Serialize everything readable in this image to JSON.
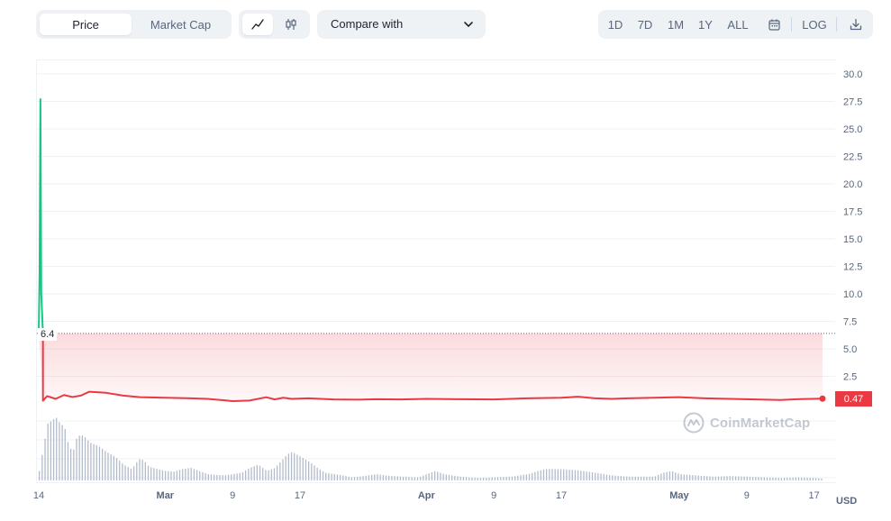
{
  "toolbar": {
    "type_tabs": [
      {
        "label": "Price",
        "active": true
      },
      {
        "label": "Market Cap",
        "active": false
      }
    ],
    "chart_types": [
      {
        "icon": "line-chart-icon",
        "active": true
      },
      {
        "icon": "candlestick-icon",
        "active": false
      }
    ],
    "compare": {
      "label": "Compare with",
      "icon": "chevron-down-icon"
    },
    "ranges": [
      {
        "label": "1D"
      },
      {
        "label": "7D"
      },
      {
        "label": "1M"
      },
      {
        "label": "1Y"
      },
      {
        "label": "ALL"
      }
    ],
    "calendar_icon": "calendar-icon",
    "log_label": "LOG",
    "download_icon": "download-icon"
  },
  "chart": {
    "open_value": "6.4",
    "last_value": "0.47",
    "currency": "USD",
    "watermark": "CoinMarketCap",
    "colors": {
      "up": "#16c784",
      "down": "#ea3943",
      "grid": "#eff2f5",
      "volume": "#a6b0c3"
    }
  },
  "chart_data": {
    "type": "line",
    "y_ticks": [
      "30.0",
      "27.5",
      "25.0",
      "22.5",
      "20.0",
      "17.5",
      "15.0",
      "12.5",
      "10.0",
      "7.5",
      "5.0",
      "2.5"
    ],
    "ylim": [
      0,
      31.25
    ],
    "x_ticks": [
      {
        "label": "14",
        "bold": false
      },
      {
        "label": "Mar",
        "bold": true
      },
      {
        "label": "9",
        "bold": false
      },
      {
        "label": "17",
        "bold": false
      },
      {
        "label": "Apr",
        "bold": true
      },
      {
        "label": "9",
        "bold": false
      },
      {
        "label": "17",
        "bold": false
      },
      {
        "label": "May",
        "bold": true
      },
      {
        "label": "9",
        "bold": false
      },
      {
        "label": "17",
        "bold": false
      }
    ],
    "x_tick_days": [
      0,
      15,
      23,
      31,
      46,
      54,
      62,
      76,
      84,
      92
    ],
    "x_range_days": [
      0,
      93
    ],
    "reference_value": 6.4,
    "series": [
      {
        "days": [
          0,
          0.1,
          0.2,
          0.3,
          0.5,
          1,
          2,
          3,
          4,
          5,
          6,
          8,
          10,
          12,
          15,
          18,
          20,
          23,
          25,
          27,
          28,
          29,
          30,
          32,
          35,
          38,
          40,
          43,
          46,
          50,
          54,
          58,
          62,
          64,
          66,
          68,
          70,
          73,
          76,
          79,
          82,
          85,
          88,
          90,
          93
        ],
        "values": [
          6.4,
          12.0,
          27.7,
          10.0,
          0.28,
          0.7,
          0.45,
          0.8,
          0.62,
          0.75,
          1.1,
          1.0,
          0.75,
          0.6,
          0.55,
          0.5,
          0.45,
          0.25,
          0.3,
          0.6,
          0.4,
          0.55,
          0.45,
          0.5,
          0.4,
          0.38,
          0.42,
          0.4,
          0.45,
          0.42,
          0.4,
          0.5,
          0.55,
          0.65,
          0.5,
          0.45,
          0.5,
          0.55,
          0.6,
          0.5,
          0.45,
          0.4,
          0.35,
          0.42,
          0.47
        ]
      }
    ],
    "volume_relative": [
      {
        "days": 0,
        "value": 0.15
      },
      {
        "days": 1,
        "value": 0.9
      },
      {
        "days": 1.5,
        "value": 0.95
      },
      {
        "days": 2,
        "value": 1.0
      },
      {
        "days": 2.5,
        "value": 0.9
      },
      {
        "days": 3,
        "value": 0.85
      },
      {
        "days": 3.5,
        "value": 0.55
      },
      {
        "days": 4,
        "value": 0.45
      },
      {
        "days": 4.5,
        "value": 0.7
      },
      {
        "days": 5,
        "value": 0.72
      },
      {
        "days": 5.5,
        "value": 0.68
      },
      {
        "days": 6,
        "value": 0.6
      },
      {
        "days": 7,
        "value": 0.55
      },
      {
        "days": 7.5,
        "value": 0.5
      },
      {
        "days": 8,
        "value": 0.45
      },
      {
        "days": 9,
        "value": 0.38
      },
      {
        "days": 10,
        "value": 0.25
      },
      {
        "days": 11,
        "value": 0.18
      },
      {
        "days": 11.5,
        "value": 0.28
      },
      {
        "days": 12,
        "value": 0.35
      },
      {
        "days": 12.5,
        "value": 0.3
      },
      {
        "days": 13,
        "value": 0.22
      },
      {
        "days": 14,
        "value": 0.18
      },
      {
        "days": 15,
        "value": 0.15
      },
      {
        "days": 16,
        "value": 0.14
      },
      {
        "days": 17,
        "value": 0.18
      },
      {
        "days": 18,
        "value": 0.2
      },
      {
        "days": 19,
        "value": 0.15
      },
      {
        "days": 20,
        "value": 0.1
      },
      {
        "days": 22,
        "value": 0.08
      },
      {
        "days": 24,
        "value": 0.12
      },
      {
        "days": 25,
        "value": 0.2
      },
      {
        "days": 26,
        "value": 0.25
      },
      {
        "days": 27,
        "value": 0.15
      },
      {
        "days": 28,
        "value": 0.2
      },
      {
        "days": 29,
        "value": 0.35
      },
      {
        "days": 29.5,
        "value": 0.42
      },
      {
        "days": 30,
        "value": 0.45
      },
      {
        "days": 31,
        "value": 0.38
      },
      {
        "days": 32,
        "value": 0.3
      },
      {
        "days": 33,
        "value": 0.2
      },
      {
        "days": 34,
        "value": 0.12
      },
      {
        "days": 36,
        "value": 0.08
      },
      {
        "days": 37,
        "value": 0.05
      },
      {
        "days": 38,
        "value": 0.06
      },
      {
        "days": 40,
        "value": 0.1
      },
      {
        "days": 41,
        "value": 0.08
      },
      {
        "days": 43,
        "value": 0.06
      },
      {
        "days": 45,
        "value": 0.05
      },
      {
        "days": 46,
        "value": 0.1
      },
      {
        "days": 47,
        "value": 0.15
      },
      {
        "days": 48,
        "value": 0.1
      },
      {
        "days": 50,
        "value": 0.06
      },
      {
        "days": 52,
        "value": 0.04
      },
      {
        "days": 54,
        "value": 0.05
      },
      {
        "days": 56,
        "value": 0.06
      },
      {
        "days": 58,
        "value": 0.1
      },
      {
        "days": 60,
        "value": 0.18
      },
      {
        "days": 62,
        "value": 0.18
      },
      {
        "days": 64,
        "value": 0.16
      },
      {
        "days": 66,
        "value": 0.12
      },
      {
        "days": 68,
        "value": 0.08
      },
      {
        "days": 70,
        "value": 0.06
      },
      {
        "days": 73,
        "value": 0.06
      },
      {
        "days": 74,
        "value": 0.12
      },
      {
        "days": 75,
        "value": 0.15
      },
      {
        "days": 76,
        "value": 0.1
      },
      {
        "days": 78,
        "value": 0.08
      },
      {
        "days": 80,
        "value": 0.06
      },
      {
        "days": 82,
        "value": 0.07
      },
      {
        "days": 84,
        "value": 0.06
      },
      {
        "days": 86,
        "value": 0.05
      },
      {
        "days": 88,
        "value": 0.04
      },
      {
        "days": 90,
        "value": 0.05
      },
      {
        "days": 92,
        "value": 0.04
      },
      {
        "days": 93,
        "value": 0.03
      }
    ]
  }
}
